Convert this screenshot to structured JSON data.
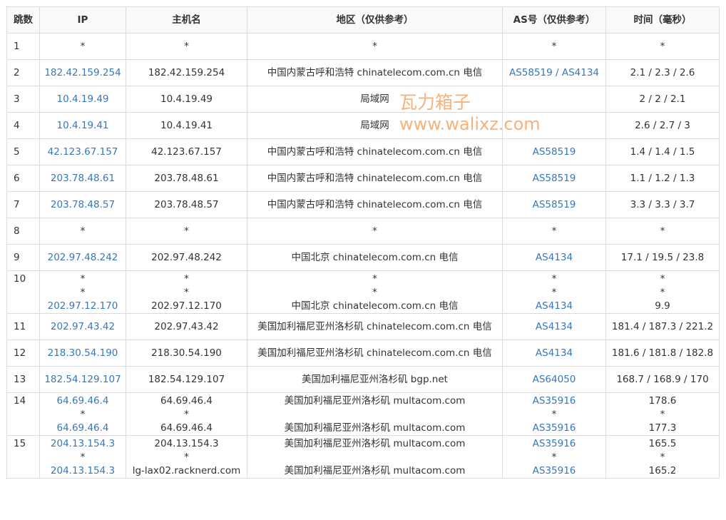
{
  "headers": {
    "hop": "跳数",
    "ip": "IP",
    "host": "主机名",
    "region": "地区（仅供参考）",
    "as": "AS号（仅供参考）",
    "time": "时间（毫秒）"
  },
  "rows": [
    {
      "hop": "1",
      "ip": [
        "*"
      ],
      "host": [
        "*"
      ],
      "region": [
        "*"
      ],
      "as": [
        "*"
      ],
      "time": [
        "*"
      ]
    },
    {
      "hop": "2",
      "ip": [
        "182.42.159.254"
      ],
      "host": [
        "182.42.159.254"
      ],
      "region": [
        "中国内蒙古呼和浩特 chinatelecom.com.cn 电信"
      ],
      "as": [
        "AS58519 / AS4134"
      ],
      "time": [
        "2.1 / 2.3 / 2.6"
      ]
    },
    {
      "hop": "3",
      "ip": [
        "10.4.19.49"
      ],
      "host": [
        "10.4.19.49"
      ],
      "region": [
        "局域网"
      ],
      "as": [
        ""
      ],
      "time": [
        "2 / 2 / 2.1"
      ]
    },
    {
      "hop": "4",
      "ip": [
        "10.4.19.41"
      ],
      "host": [
        "10.4.19.41"
      ],
      "region": [
        "局域网"
      ],
      "as": [
        ""
      ],
      "time": [
        "2.6 / 2.7 / 3"
      ]
    },
    {
      "hop": "5",
      "ip": [
        "42.123.67.157"
      ],
      "host": [
        "42.123.67.157"
      ],
      "region": [
        "中国内蒙古呼和浩特 chinatelecom.com.cn 电信"
      ],
      "as": [
        "AS58519"
      ],
      "time": [
        "1.4 / 1.4 / 1.5"
      ]
    },
    {
      "hop": "6",
      "ip": [
        "203.78.48.61"
      ],
      "host": [
        "203.78.48.61"
      ],
      "region": [
        "中国内蒙古呼和浩特 chinatelecom.com.cn 电信"
      ],
      "as": [
        "AS58519"
      ],
      "time": [
        "1.1 / 1.2 / 1.3"
      ]
    },
    {
      "hop": "7",
      "ip": [
        "203.78.48.57"
      ],
      "host": [
        "203.78.48.57"
      ],
      "region": [
        "中国内蒙古呼和浩特 chinatelecom.com.cn 电信"
      ],
      "as": [
        "AS58519"
      ],
      "time": [
        "3.3 / 3.3 / 3.7"
      ]
    },
    {
      "hop": "8",
      "ip": [
        "*"
      ],
      "host": [
        "*"
      ],
      "region": [
        "*"
      ],
      "as": [
        "*"
      ],
      "time": [
        "*"
      ]
    },
    {
      "hop": "9",
      "ip": [
        "202.97.48.242"
      ],
      "host": [
        "202.97.48.242"
      ],
      "region": [
        "中国北京 chinatelecom.com.cn 电信"
      ],
      "as": [
        "AS4134"
      ],
      "time": [
        "17.1 / 19.5 / 23.8"
      ]
    },
    {
      "hop": "10",
      "ip": [
        "*",
        "*",
        "202.97.12.170"
      ],
      "host": [
        "*",
        "*",
        "202.97.12.170"
      ],
      "region": [
        "*",
        "*",
        "中国北京 chinatelecom.com.cn 电信"
      ],
      "as": [
        "*",
        "*",
        "AS4134"
      ],
      "time": [
        "*",
        "*",
        "9.9"
      ]
    },
    {
      "hop": "11",
      "ip": [
        "202.97.43.42"
      ],
      "host": [
        "202.97.43.42"
      ],
      "region": [
        "美国加利福尼亚州洛杉矶 chinatelecom.com.cn 电信"
      ],
      "as": [
        "AS4134"
      ],
      "time": [
        "181.4 / 187.3 / 221.2"
      ]
    },
    {
      "hop": "12",
      "ip": [
        "218.30.54.190"
      ],
      "host": [
        "218.30.54.190"
      ],
      "region": [
        "美国加利福尼亚州洛杉矶 chinatelecom.com.cn 电信"
      ],
      "as": [
        "AS4134"
      ],
      "time": [
        "181.6 / 181.8 / 182.8"
      ]
    },
    {
      "hop": "13",
      "ip": [
        "182.54.129.107"
      ],
      "host": [
        "182.54.129.107"
      ],
      "region": [
        "美国加利福尼亚州洛杉矶 bgp.net"
      ],
      "as": [
        "AS64050"
      ],
      "time": [
        "168.7 / 168.9 / 170"
      ]
    },
    {
      "hop": "14",
      "ip": [
        "64.69.46.4",
        "*",
        "64.69.46.4"
      ],
      "host": [
        "64.69.46.4",
        "*",
        "64.69.46.4"
      ],
      "region": [
        "美国加利福尼亚州洛杉矶 multacom.com",
        "",
        "美国加利福尼亚州洛杉矶 multacom.com"
      ],
      "as": [
        "AS35916",
        "*",
        "AS35916"
      ],
      "time": [
        "178.6",
        "*",
        "177.3"
      ]
    },
    {
      "hop": "15",
      "ip": [
        "204.13.154.3",
        "*",
        "204.13.154.3"
      ],
      "host": [
        "204.13.154.3",
        "*",
        "lg-lax02.racknerd.com"
      ],
      "region": [
        "美国加利福尼亚州洛杉矶 multacom.com",
        "",
        "美国加利福尼亚州洛杉矶 multacom.com"
      ],
      "as": [
        "AS35916",
        "*",
        "AS35916"
      ],
      "time": [
        "165.5",
        "*",
        "165.2"
      ]
    }
  ],
  "watermark": {
    "title": "瓦力箱子",
    "url": "www.walixz.com",
    "color": "#f5a566"
  },
  "colors": {
    "link": "#3877b9",
    "border": "#dcdcdc",
    "header_bg": "#f9f9f9"
  }
}
